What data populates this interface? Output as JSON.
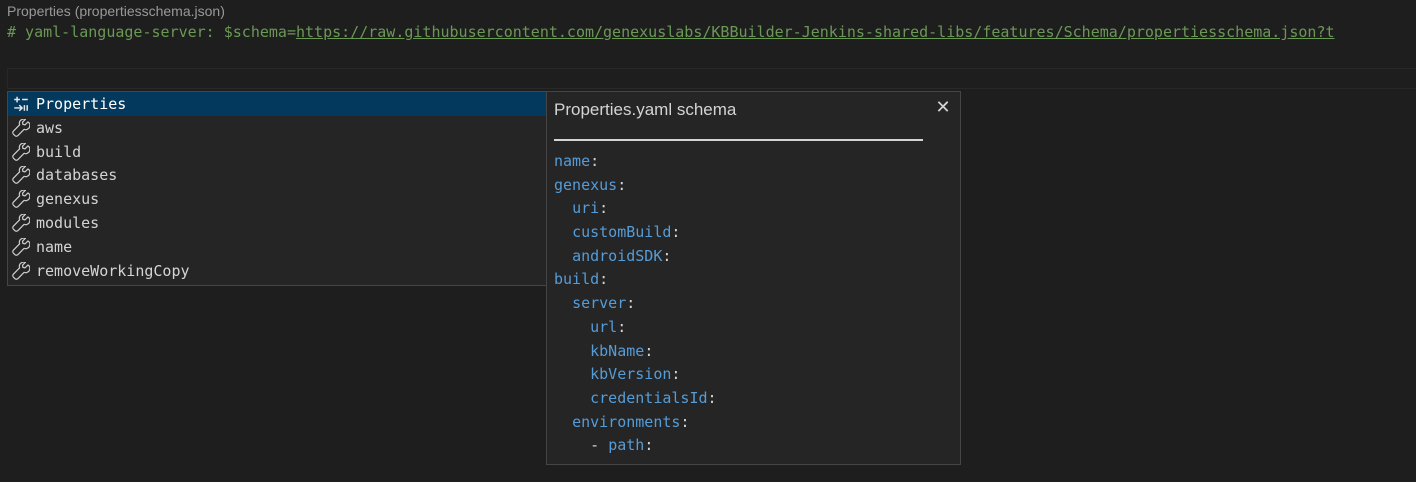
{
  "codelens": {
    "text": "Properties (propertiesschema.json)"
  },
  "editor": {
    "line1_prefix": "# yaml-language-server: $schema=",
    "line1_link": "https://raw.githubusercontent.com/genexuslabs/KBBuilder-Jenkins-shared-libs/features/Schema/propertiesschema.json?t"
  },
  "suggest": {
    "items": [
      {
        "label": "Properties",
        "icon": "snippet-icon",
        "selected": true
      },
      {
        "label": "aws",
        "icon": "wrench-icon"
      },
      {
        "label": "build",
        "icon": "wrench-icon"
      },
      {
        "label": "databases",
        "icon": "wrench-icon"
      },
      {
        "label": "genexus",
        "icon": "wrench-icon"
      },
      {
        "label": "modules",
        "icon": "wrench-icon"
      },
      {
        "label": "name",
        "icon": "wrench-icon"
      },
      {
        "label": "removeWorkingCopy",
        "icon": "wrench-icon"
      }
    ]
  },
  "details": {
    "title": "Properties.yaml schema",
    "close_icon": "close-icon",
    "lines": [
      {
        "indent": "",
        "key": "name",
        "suffix": ":"
      },
      {
        "indent": "",
        "key": "genexus",
        "suffix": ":"
      },
      {
        "indent": "  ",
        "key": "uri",
        "suffix": ":"
      },
      {
        "indent": "  ",
        "key": "customBuild",
        "suffix": ":"
      },
      {
        "indent": "  ",
        "key": "androidSDK",
        "suffix": ":"
      },
      {
        "indent": "",
        "key": "build",
        "suffix": ":"
      },
      {
        "indent": "  ",
        "key": "server",
        "suffix": ":"
      },
      {
        "indent": "    ",
        "key": "url",
        "suffix": ":"
      },
      {
        "indent": "    ",
        "key": "kbName",
        "suffix": ":"
      },
      {
        "indent": "    ",
        "key": "kbVersion",
        "suffix": ":"
      },
      {
        "indent": "    ",
        "key": "credentialsId",
        "suffix": ":"
      },
      {
        "indent": "  ",
        "key": "environments",
        "suffix": ":"
      },
      {
        "indent": "    - ",
        "key": "path",
        "suffix": ":"
      }
    ]
  },
  "colors": {
    "background": "#1e1e1e",
    "widget_bg": "#252526",
    "selected_bg": "#04395e",
    "comment": "#6a9955",
    "yaml_key": "#569cd6"
  }
}
